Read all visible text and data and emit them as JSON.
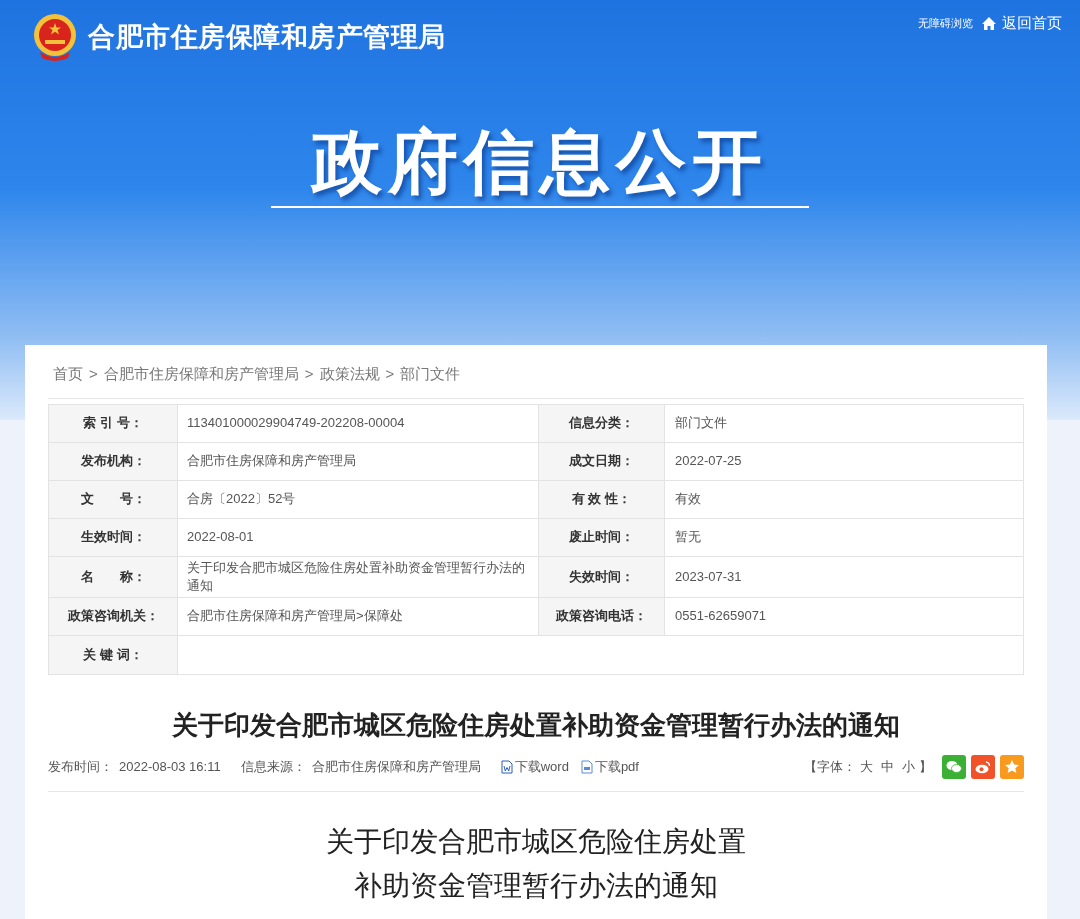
{
  "header": {
    "site_title": "合肥市住房保障和房产管理局",
    "accessibility_link": "无障碍浏览",
    "home_link": "返回首页"
  },
  "banner": {
    "title": "政府信息公开"
  },
  "breadcrumb": [
    "首页",
    "合肥市住房保障和房产管理局",
    "政策法规",
    "部门文件"
  ],
  "breadcrumb_separator": ">",
  "info_table": [
    {
      "label": "索 引 号：",
      "value": "113401000029904749-202208-00004",
      "label_2": "信息分类：",
      "value_2": "部门文件"
    },
    {
      "label": "发布机构：",
      "value": "合肥市住房保障和房产管理局",
      "label_2": "成文日期：",
      "value_2": "2022-07-25"
    },
    {
      "label": "文　　号：",
      "value": "合房〔2022〕52号",
      "label_2": "有 效 性：",
      "value_2": "有效"
    },
    {
      "label": "生效时间：",
      "value": "2022-08-01",
      "label_2": "废止时间：",
      "value_2": "暂无"
    },
    {
      "label": "名　　称：",
      "value": "关于印发合肥市城区危险住房处置补助资金管理暂行办法的通知",
      "label_2": "失效时间：",
      "value_2": "2023-07-31"
    },
    {
      "label": "政策咨询机关：",
      "value": "合肥市住房保障和房产管理局>保障处",
      "label_2": "政策咨询电话：",
      "value_2": "0551-62659071"
    },
    {
      "label": "关 键 词："
    }
  ],
  "article": {
    "title": "关于印发合肥市城区危险住房处置补助资金管理暂行办法的通知",
    "meta": [
      {
        "label": "发布时间：",
        "value": "2022-08-03 16:11"
      },
      {
        "label": "信息来源：",
        "value": "合肥市住房保障和房产管理局"
      }
    ],
    "downloads": [
      {
        "kind": "word",
        "label": "下载word"
      },
      {
        "kind": "pdf",
        "label": "下载pdf"
      }
    ],
    "font_size": {
      "open": "【字体：",
      "options": [
        "大",
        "中",
        "小"
      ],
      "close": "】"
    },
    "share": [
      {
        "kind": "chat",
        "color": "#3cb034"
      },
      {
        "kind": "weibo",
        "color": "#f0532a"
      },
      {
        "kind": "favorite",
        "color": "#f79a1e"
      }
    ],
    "body_title": [
      "关于印发合肥市城区危险住房处置",
      "补助资金管理暂行办法的通知"
    ]
  }
}
